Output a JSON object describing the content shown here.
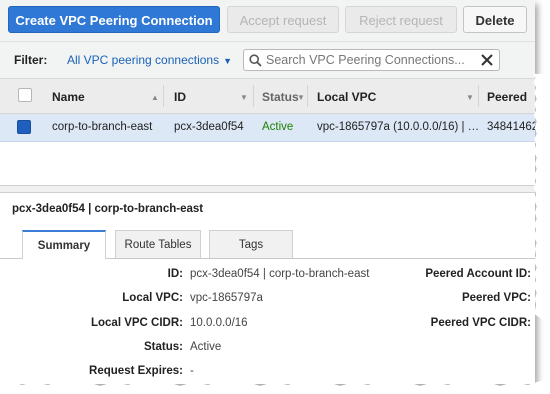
{
  "toolbar": {
    "create_label": "Create VPC Peering Connection",
    "accept_label": "Accept request",
    "reject_label": "Reject request",
    "delete_label": "Delete"
  },
  "filter": {
    "label": "Filter:",
    "selected": "All VPC peering connections",
    "search_placeholder": "Search VPC Peering Connections..."
  },
  "grid": {
    "columns": [
      "Name",
      "ID",
      "Status",
      "Local VPC",
      "Peered"
    ],
    "rows": [
      {
        "name": "corp-to-branch-east",
        "id": "pcx-3dea0f54",
        "status": "Active",
        "local_vpc": "vpc-1865797a (10.0.0.0/16) | …",
        "peered": "34841462"
      }
    ]
  },
  "details": {
    "title": "pcx-3dea0f54 | corp-to-branch-east",
    "tabs": [
      "Summary",
      "Route Tables",
      "Tags"
    ],
    "left_fields": [
      {
        "label": "ID:",
        "value": "pcx-3dea0f54 | corp-to-branch-east"
      },
      {
        "label": "Local VPC:",
        "value": "vpc-1865797a"
      },
      {
        "label": "Local VPC CIDR:",
        "value": "10.0.0.0/16"
      },
      {
        "label": "Status:",
        "value": "Active"
      },
      {
        "label": "Request Expires:",
        "value": "-"
      }
    ],
    "right_fields": [
      {
        "label": "Peered Account ID:"
      },
      {
        "label": "Peered VPC:"
      },
      {
        "label": "Peered VPC CIDR:"
      }
    ]
  },
  "colors": {
    "primary": "#2f78d6",
    "selected_row": "#dde8f6",
    "active_status": "#1d8102",
    "link": "#1a62b8"
  }
}
